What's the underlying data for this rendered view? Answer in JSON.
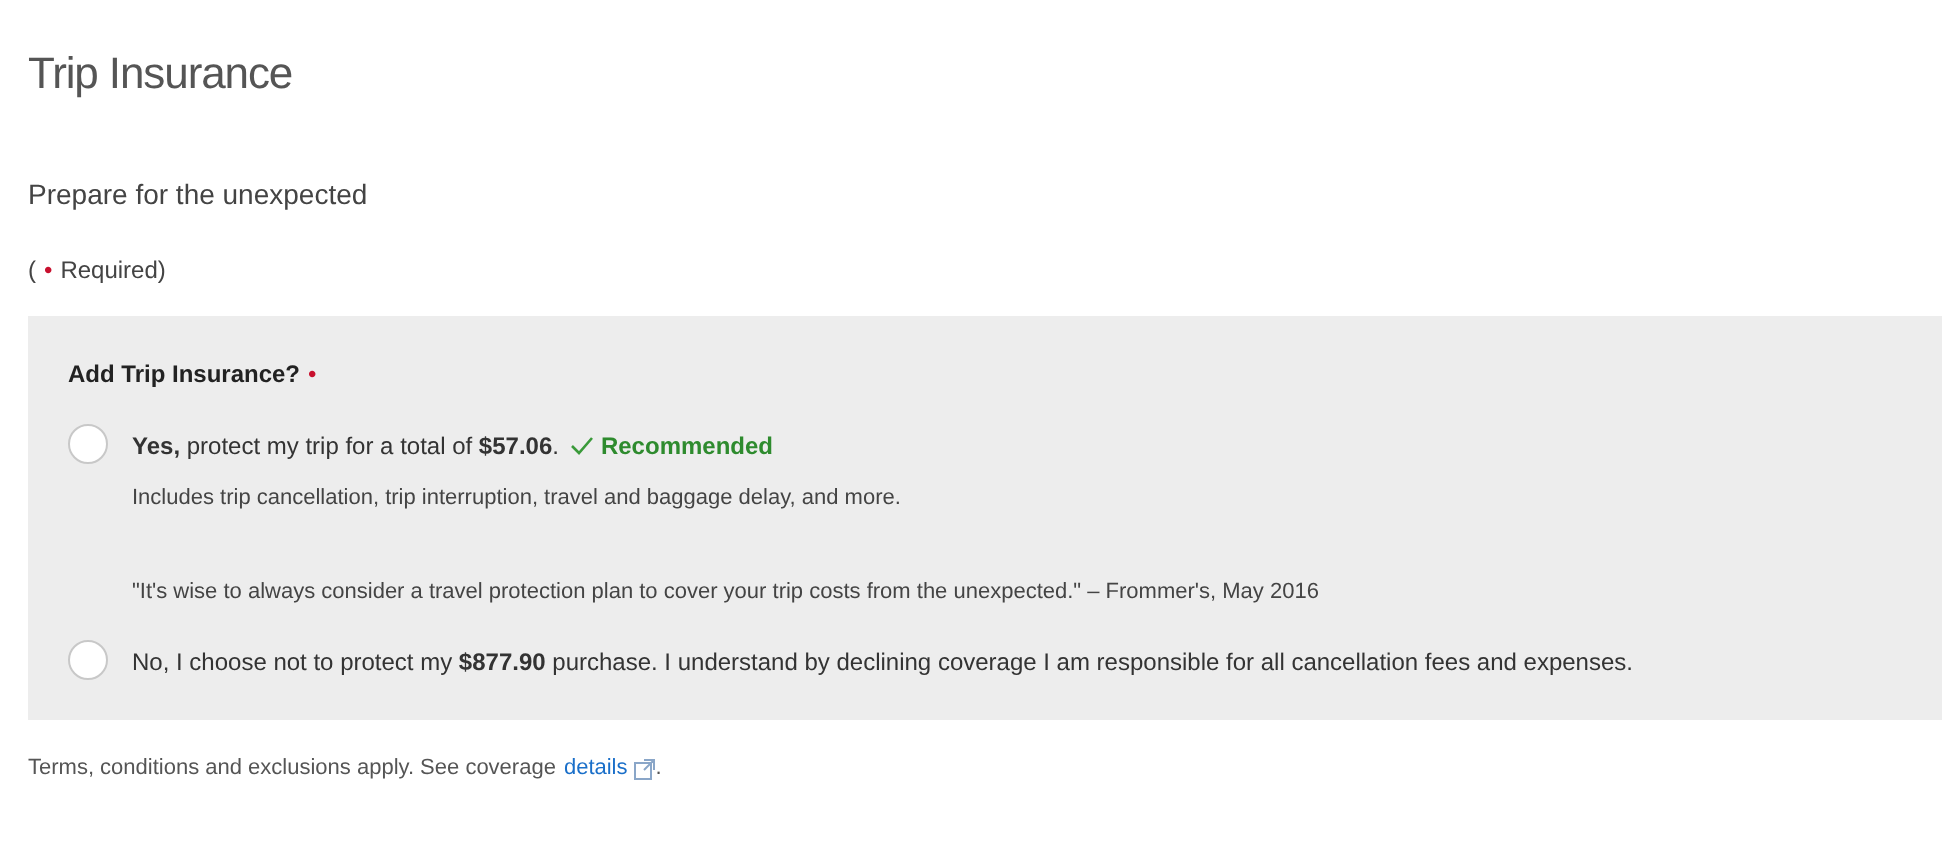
{
  "title": "Trip Insurance",
  "subtitle": "Prepare for the unexpected",
  "required_note": {
    "open": "(",
    "mark": "•",
    "text": "Required)"
  },
  "question": {
    "label": "Add Trip Insurance?",
    "required_mark": "•",
    "options": [
      {
        "selected": false,
        "text": "**Yes,** protect my trip for a total of **$57.06**.",
        "badge": "Recommended",
        "details": [
          "Includes trip cancellation, trip interruption, travel and baggage delay, and more.",
          "\"It's wise to always consider a travel protection plan to cover your trip costs from the unexpected.\" – Frommer's, May 2016"
        ]
      },
      {
        "selected": false,
        "text": "No, I choose not to protect my **$877.90** purchase. I understand by declining coverage I am responsible for all cancellation fees and expenses."
      }
    ]
  },
  "footer": {
    "text": "Terms, conditions and exclusions apply. See coverage",
    "link": "details",
    "end": "."
  }
}
